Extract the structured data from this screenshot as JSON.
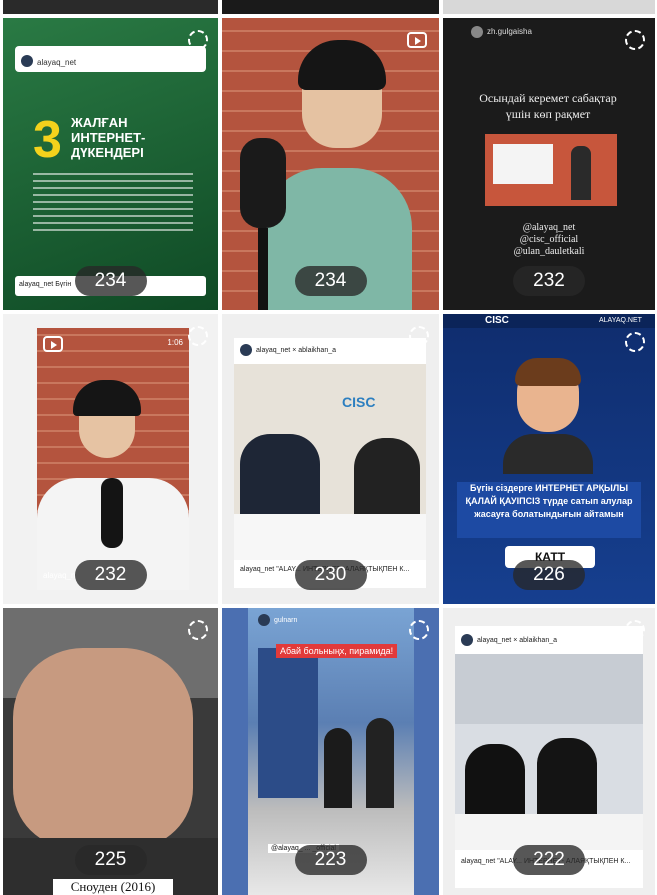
{
  "tiles": [
    {
      "count": "234",
      "handle": "alayaq_net",
      "number": "3",
      "title": "ЖАЛҒАН ИНТЕРНЕТ-ДҮКЕНДЕРІ",
      "caption": "alayaq_net Бүгін"
    },
    {
      "count": "234"
    },
    {
      "count": "232",
      "handle": "zh.gulgaisha",
      "quote": "Осындай керемет сабақтар үшін көп рақмет",
      "mentions": [
        "@alayaq_net",
        "@cisc_official",
        "@ulan_dauletkali"
      ]
    },
    {
      "count": "232",
      "duration": "1:06",
      "handle": "alayaq_n"
    },
    {
      "count": "230",
      "handle": "alayaq_net",
      "collab": "ablaikhan_a",
      "brand": "CISC",
      "caption": "alayaq_net \"ALAY... ИНТЕРНЕТ- АЛАЯҚТЫҚПЕН К..."
    },
    {
      "count": "226",
      "header_brands": [
        "CISC",
        "ALAYAQ.NET"
      ],
      "banner": "Бүгін сіздерге ИНТЕРНЕТ АРҚЫЛЫ ҚАЛАЙ ҚАУІПСІЗ түрде сатып алулар жасауға болатындығын айтамын",
      "button": "КАТТ"
    },
    {
      "count": "225",
      "subtitle": "Сноуден (2016)"
    },
    {
      "count": "223",
      "handle": "gulnarn",
      "banner": "Абай больныңх, пирамида!",
      "mention": "@alayaq_ ... _official"
    },
    {
      "count": "222",
      "handle": "alayaq_net",
      "collab": "ablaikhan_a",
      "caption": "alayaq_net \"ALAY... ИНТЕРНЕТ- АЛАЯҚТЫҚПЕН К..."
    }
  ],
  "colors": {
    "green": "#1f6b3a",
    "blue": "#14357a",
    "brick": "#b4543e"
  }
}
